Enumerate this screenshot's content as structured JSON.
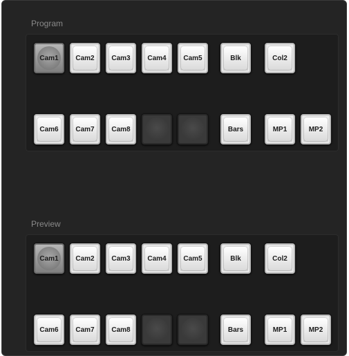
{
  "program": {
    "label": "Program",
    "row1": [
      "Cam1",
      "Cam2",
      "Cam3",
      "Cam4",
      "Cam5",
      "Blk",
      "Col2"
    ],
    "row2": [
      "Cam6",
      "Cam7",
      "Cam8",
      "",
      "",
      "Bars",
      "MP1",
      "MP2"
    ]
  },
  "preview": {
    "label": "Preview",
    "row1": [
      "Cam1",
      "Cam2",
      "Cam3",
      "Cam4",
      "Cam5",
      "Blk",
      "Col2"
    ],
    "row2": [
      "Cam6",
      "Cam7",
      "Cam8",
      "",
      "",
      "Bars",
      "MP1",
      "MP2"
    ]
  },
  "selected": {
    "program": "Cam1",
    "preview": "Cam1"
  },
  "colors": {
    "panel_bg": "#242424",
    "label": "#8a8a8a",
    "button_lit": "#e6e6e6",
    "button_dark": "#3a3a3a"
  }
}
